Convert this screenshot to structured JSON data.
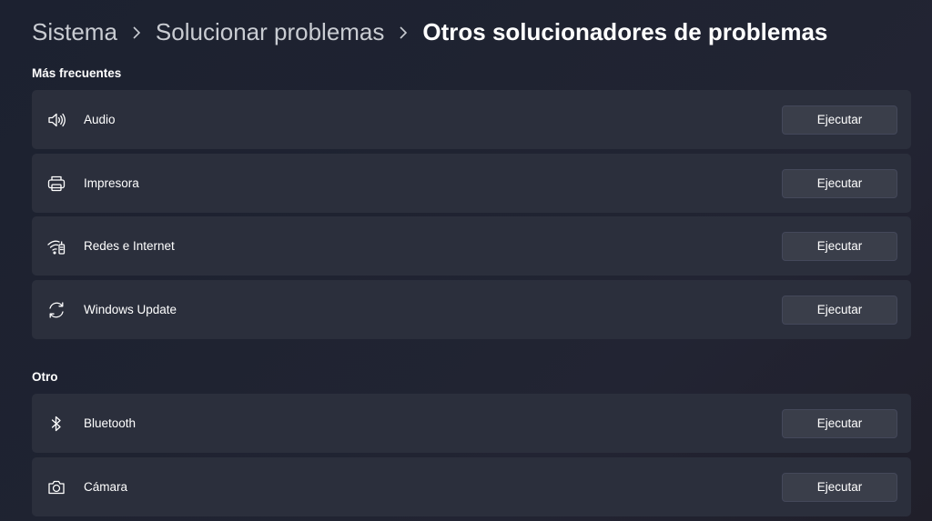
{
  "breadcrumb": {
    "items": [
      "Sistema",
      "Solucionar problemas"
    ],
    "current": "Otros solucionadores de problemas"
  },
  "sections": {
    "frequent": {
      "title": "Más frecuentes",
      "items": [
        {
          "label": "Audio",
          "icon": "speaker-icon",
          "button": "Ejecutar"
        },
        {
          "label": "Impresora",
          "icon": "printer-icon",
          "button": "Ejecutar"
        },
        {
          "label": "Redes e Internet",
          "icon": "wifi-icon",
          "button": "Ejecutar"
        },
        {
          "label": "Windows Update",
          "icon": "sync-icon",
          "button": "Ejecutar"
        }
      ]
    },
    "other": {
      "title": "Otro",
      "items": [
        {
          "label": "Bluetooth",
          "icon": "bluetooth-icon",
          "button": "Ejecutar"
        },
        {
          "label": "Cámara",
          "icon": "camera-icon",
          "button": "Ejecutar"
        }
      ]
    }
  }
}
